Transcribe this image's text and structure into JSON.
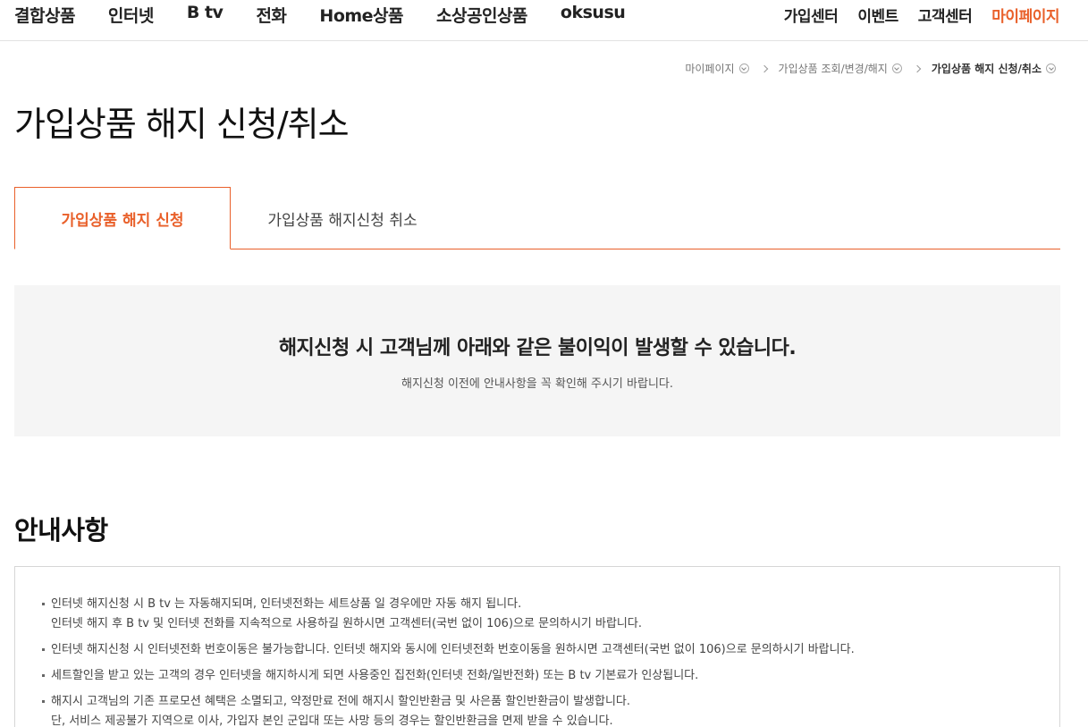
{
  "nav": {
    "left": [
      "결합상품",
      "인터넷",
      "B tv",
      "전화",
      "Home상품",
      "소상공인상품",
      "oksusu"
    ],
    "right": [
      "가입센터",
      "이벤트",
      "고객센터",
      "마이페이지"
    ],
    "accent": "#e9602a"
  },
  "breadcrumb": [
    "마이페이지",
    "가입상품 조회/변경/해지",
    "가입상품 해지 신청/취소"
  ],
  "page_title": "가입상품 해지 신청/취소",
  "tabs": [
    {
      "label": "가입상품 해지 신청",
      "active": true
    },
    {
      "label": "가입상품 해지신청 취소",
      "active": false
    }
  ],
  "notice": {
    "title": "해지신청 시 고객님께 아래와 같은 불이익이 발생할 수 있습니다.",
    "subtitle": "해지신청 이전에 안내사항을 꼭 확인해 주시기 바랍니다."
  },
  "section_title": "안내사항",
  "info_items": [
    {
      "lines": [
        "인터넷 해지신청 시 B tv 는 자동해지되며, 인터넷전화는 세트상품 일 경우에만 자동 해지 됩니다.",
        "인터넷 해지 후 B tv 및 인터넷 전화를 지속적으로 사용하길 원하시면 고객센터(국번 없이 106)으로 문의하시기 바랍니다."
      ]
    },
    {
      "lines": [
        "인터넷 해지신청 시 인터넷전화 번호이동은 불가능합니다. 인터넷 해지와 동시에 인터넷전화 번호이동을 원하시면 고객센터(국번 없이 106)으로 문의하시기 바랍니다."
      ]
    },
    {
      "lines": [
        "세트할인을 받고 있는 고객의 경우 인터넷을 해지하시게 되면 사용중인 집전화(인터넷 전화/일반전화) 또는 B tv 기본료가 인상됩니다."
      ]
    },
    {
      "lines": [
        "해지시 고객님의 기존 프로모션 혜택은 소멸되고, 약정만료 전에 해지시 할인반환금 및 사은품 할인반환금이 발생합니다.",
        "단, 서비스 제공불가 지역으로 이사, 가입자 본인 군입대 또는 사망 등의 경우는 할인반환금을 면제 받을 수 있습니다."
      ]
    }
  ]
}
